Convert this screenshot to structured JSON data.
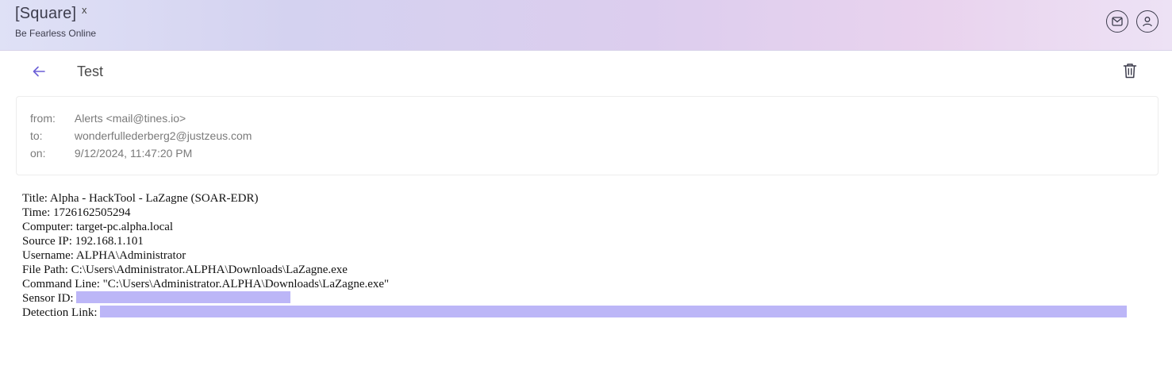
{
  "app": {
    "title": "[Square]",
    "title_suffix": "x",
    "subtitle": "Be Fearless Online"
  },
  "header_icons": {
    "mail": "mail-icon",
    "user": "user-icon"
  },
  "message": {
    "subject": "Test",
    "from_label": "from:",
    "from_value": "Alerts <mail@tines.io>",
    "to_label": "to:",
    "to_value": "wonderfullederberg2@justzeus.com",
    "on_label": "on:",
    "on_value": "9/12/2024, 11:47:20 PM"
  },
  "body": {
    "title": "Title: Alpha - HackTool - LaZagne (SOAR-EDR)",
    "time": "Time: 1726162505294",
    "computer": "Computer: target-pc.alpha.local",
    "source_ip": "Source IP: 192.168.1.101",
    "username": "Username: ALPHA\\Administrator",
    "file_path": "File Path: C:\\Users\\Administrator.ALPHA\\Downloads\\LaZagne.exe",
    "command_line": "Command Line: \"C:\\Users\\Administrator.ALPHA\\Downloads\\LaZagne.exe\"",
    "sensor_label": "Sensor ID: ",
    "detection_label": "Detection Link: "
  },
  "colors": {
    "accent": "#6b5fd6",
    "redaction": "#bcb6f7"
  }
}
